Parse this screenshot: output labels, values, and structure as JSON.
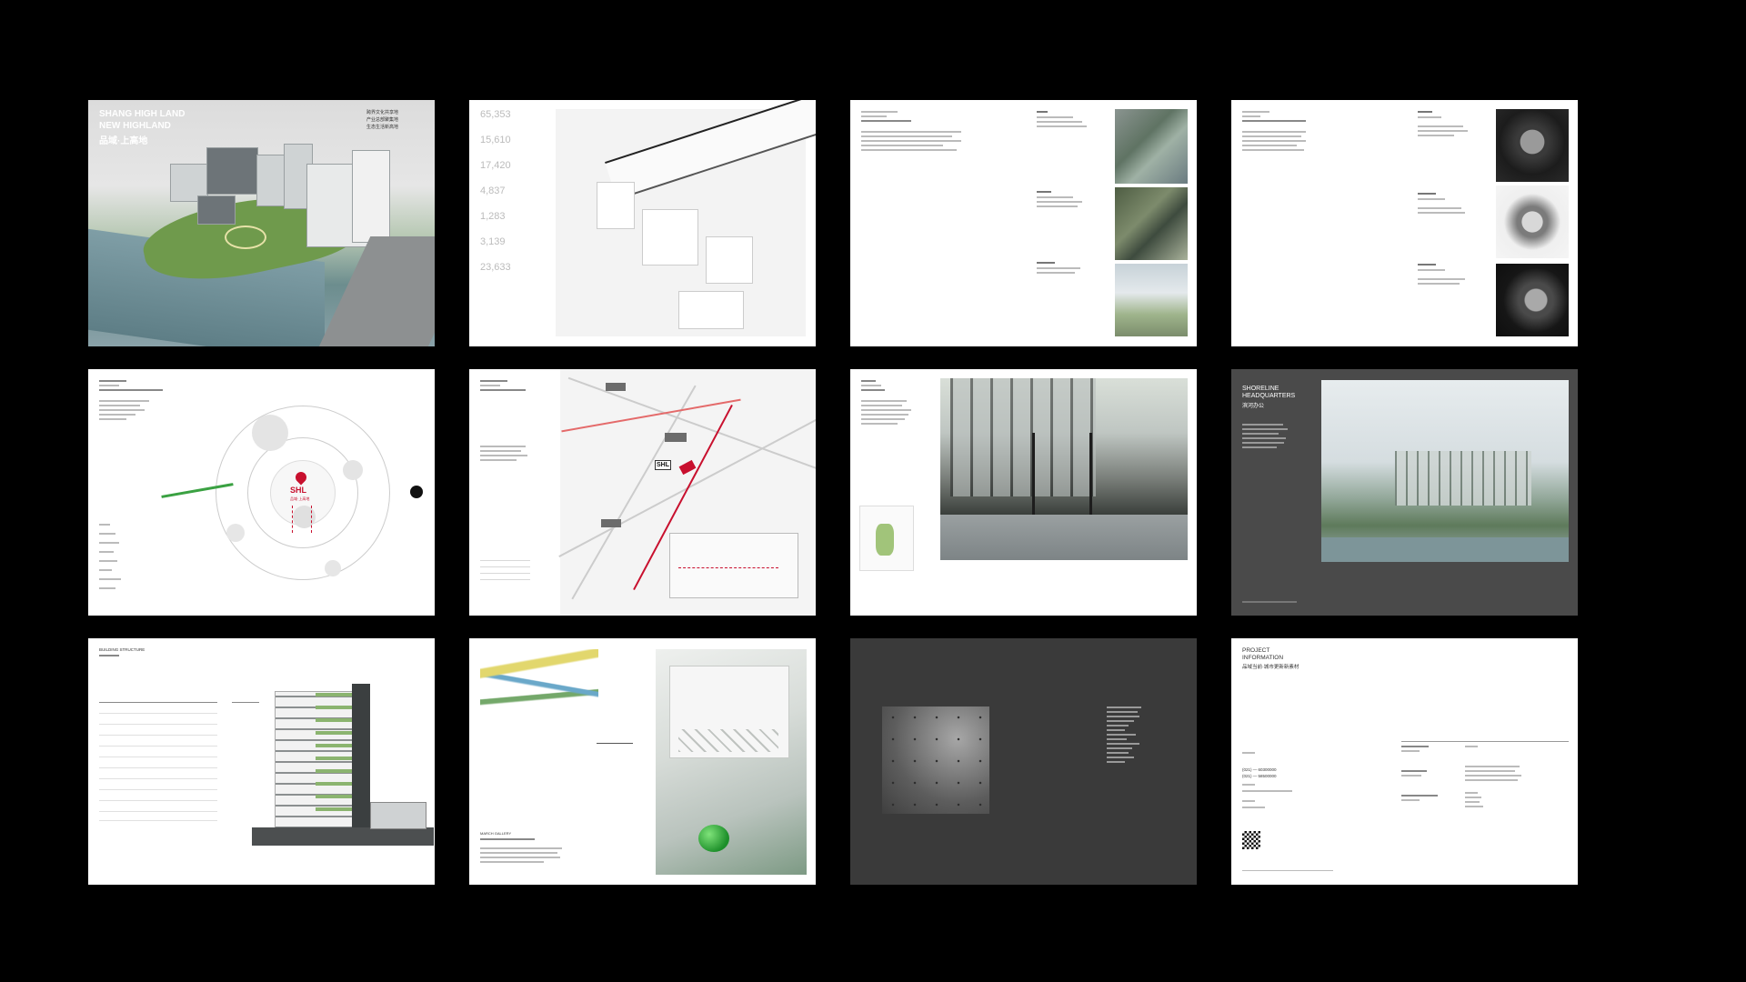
{
  "cover": {
    "title_en_1": "SHANG HIGH LAND",
    "title_en_2": "NEW HIGHLAND",
    "title_cn": "品域·上高地",
    "tagline_1": "跨界文化共享地",
    "tagline_2": "产业总部聚集地",
    "tagline_3": "生态生活新高地"
  },
  "stats": {
    "values": [
      "65,353",
      "15,610",
      "17,420",
      "4,837",
      "1,283",
      "3,139",
      "23,633"
    ]
  },
  "map": {
    "brand_logo": "SHL",
    "brand_cn": "品域·上高地",
    "right_icon_text": "SHL"
  },
  "shoreline": {
    "title_1": "SHORELINE",
    "title_2": "HEADQUARTERS",
    "title_cn": "滨河办公"
  },
  "structure": {
    "heading": "BUILDING STRUCTURE"
  },
  "project": {
    "title_1": "PROJECT",
    "title_2": "INFORMATION",
    "subtitle_cn": "品域当前·城市更新新素材",
    "tele_1": "(021) — 60300000",
    "tele_2": "(021) — 58500000"
  },
  "sketch": {
    "title": "MARCH GALLERY"
  },
  "colors": {
    "background": "#000000",
    "accent_red": "#c8102e",
    "dark_page": "#4a4a4a"
  }
}
